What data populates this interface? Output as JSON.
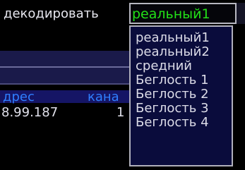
{
  "settings": {
    "decode_label": "декодировать",
    "decode_select": {
      "value": "реальный1",
      "value_color": "#22e018"
    }
  },
  "table": {
    "columns": [
      "дрес",
      "кана"
    ],
    "rows": [
      [
        "8.99.187",
        "1"
      ]
    ]
  },
  "dropdown": {
    "options": [
      "реальный1",
      "реальный2",
      "средний",
      "Беглость 1",
      "Беглость 2",
      "Беглость 3",
      "Беглость 4"
    ]
  },
  "colors": {
    "background": "#000000",
    "dropdown_background": "#0a0c3c",
    "header_text": "#2f7fff",
    "selected_text": "#22e018"
  }
}
